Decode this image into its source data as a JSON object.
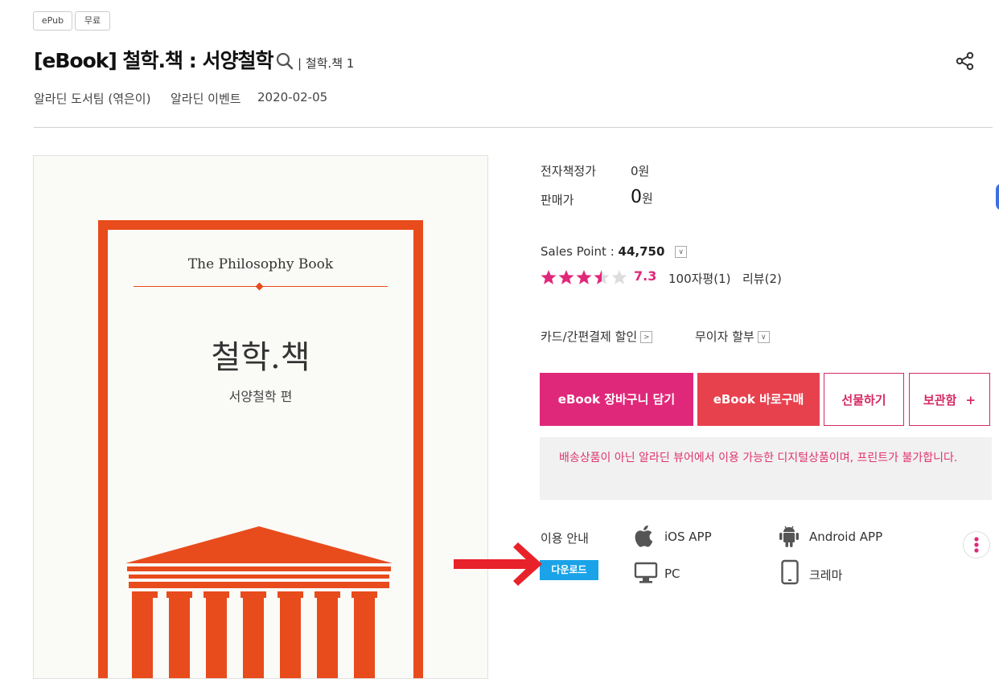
{
  "tags": [
    "ePub",
    "무료"
  ],
  "title": "[eBook] 철학.책 : 서양철학",
  "series": "| 철학.책 1",
  "meta": {
    "author": "알라딘 도서팀 (엮은이)",
    "publisher": "알라딘 이벤트",
    "date": "2020-02-05"
  },
  "cover": {
    "title_en": "The Philosophy Book",
    "title_ko": "철학.책",
    "subtitle": "서양철학 편"
  },
  "pricing": {
    "list_label": "전자책정가",
    "list_price": "0원",
    "sale_label": "판매가",
    "sale_price": "0",
    "sale_unit": "원"
  },
  "sales_point": {
    "label": "Sales Point : ",
    "value": "44,750",
    "rating": 3.5,
    "rating_text": "7.3",
    "short_reviews": "100자평(1)",
    "reviews": "리뷰(2)"
  },
  "discounts": {
    "card": "카드/간편결제 할인",
    "installment": "무이자 할부"
  },
  "buttons": {
    "cart": "eBook 장바구니 담기",
    "buy": "eBook 바로구매",
    "gift": "선물하기",
    "wishlist": "보관함",
    "wishlist_plus": "+"
  },
  "notice": "배송상품이 아닌 알라딘 뷰어에서 이용 가능한 디지털상품이며, 프린트가 불가합니다.",
  "usage": {
    "label": "이용 안내",
    "download": "다운로드",
    "ios": "iOS APP",
    "android": "Android APP",
    "pc": "PC",
    "crema": "크레마"
  },
  "colors": {
    "brand_pink": "#e0287a",
    "brand_red": "#e8414e",
    "cover_orange": "#e84b1c",
    "download_blue": "#1aa3e8",
    "annotation_arrow": "#e8222a"
  },
  "icons": [
    "search-icon",
    "share-icon",
    "star-icon",
    "apple-icon",
    "android-icon",
    "monitor-icon",
    "tablet-icon",
    "more-icon",
    "arrow-icon"
  ]
}
